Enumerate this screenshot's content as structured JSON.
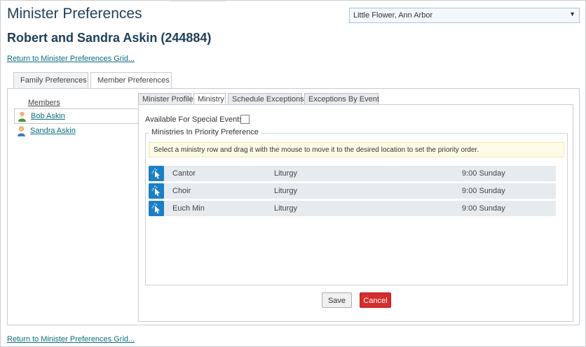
{
  "page": {
    "title": "Minister Preferences",
    "subtitle": "Robert and Sandra Askin (244884)",
    "return_link_top": "Return to Minister Preferences Grid...",
    "return_link_bottom": "Return to Minister Preferences Grid..."
  },
  "parish_select": {
    "value": "Little Flower, Ann Arbor",
    "arrow": "▼"
  },
  "outer_tabs": [
    {
      "label": "Family Preferences",
      "active": false
    },
    {
      "label": "Member Preferences",
      "active": true
    }
  ],
  "members": {
    "header": "Members",
    "items": [
      {
        "name": "Bob Askin",
        "selected": true,
        "icon": "male-person-icon"
      },
      {
        "name": "Sandra Askin",
        "selected": false,
        "icon": "female-person-icon"
      }
    ]
  },
  "inner_tabs": [
    {
      "label": "Minister Profile",
      "active": false
    },
    {
      "label": "Ministry",
      "active": true
    },
    {
      "label": "Schedule Exceptions",
      "active": false
    },
    {
      "label": "Exceptions By Event",
      "active": false
    }
  ],
  "ministry_tab": {
    "special_events_label": "Available For Special Events?",
    "special_events_checked": false,
    "section_legend": "Ministries In Priority Preference",
    "hint": "Select a ministry row and drag it with the mouse to move it to the desired location to set the priority order.",
    "rows": [
      {
        "ministry": "Cantor",
        "category": "Liturgy",
        "time": "9:00 Sunday"
      },
      {
        "ministry": "Choir",
        "category": "Liturgy",
        "time": "9:00 Sunday"
      },
      {
        "ministry": "Euch Min",
        "category": "Liturgy",
        "time": "9:00 Sunday"
      }
    ],
    "save_label": "Save",
    "cancel_label": "Cancel"
  },
  "colors": {
    "title": "#1e3f5a",
    "link": "#0b6e7d",
    "drag_icon": "#1b7fc6",
    "cancel": "#d52c2c",
    "row_bg": "#e6ebef",
    "hint_bg": "#fdfbe6"
  }
}
